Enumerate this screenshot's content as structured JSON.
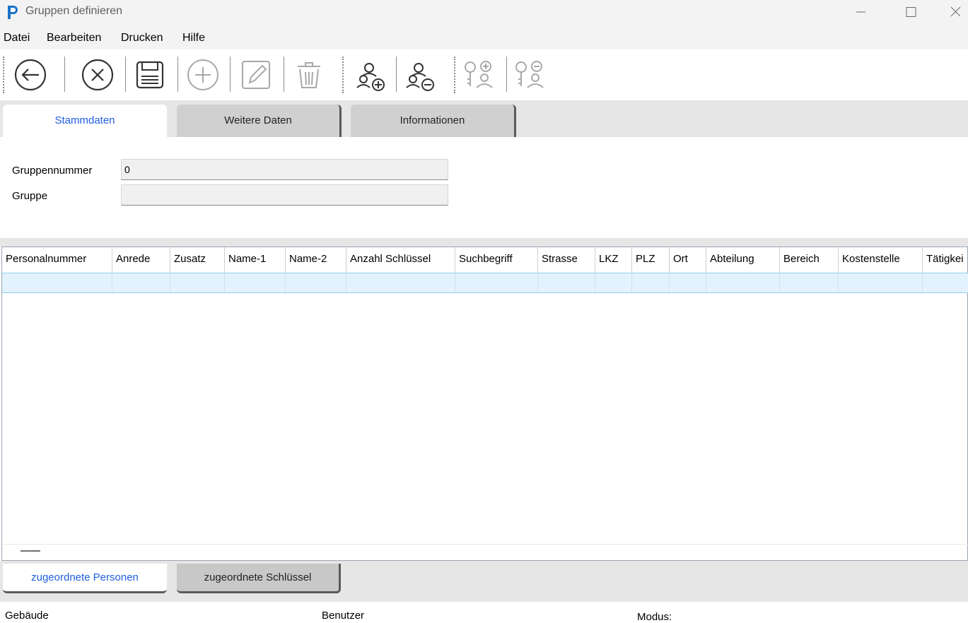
{
  "window": {
    "title": "Gruppen definieren"
  },
  "menu": [
    "Datei",
    "Bearbeiten",
    "Drucken",
    "Hilfe"
  ],
  "toolbar": {
    "buttons": [
      "back-icon",
      "cancel-icon",
      "save-icon",
      "add-icon",
      "edit-icon",
      "delete-icon",
      "add-persons-icon",
      "remove-persons-icon",
      "add-keys-icon",
      "remove-keys-icon"
    ],
    "disabled": [
      "add-icon",
      "edit-icon",
      "delete-icon",
      "add-keys-icon",
      "remove-keys-icon"
    ]
  },
  "tabs": [
    "Stammdaten",
    "Weitere Daten",
    "Informationen"
  ],
  "form": {
    "gruppennummer_label": "Gruppennummer",
    "gruppennummer_value": "0",
    "gruppe_label": "Gruppe",
    "gruppe_value": ""
  },
  "grid": {
    "columns": [
      "Personalnummer",
      "Anrede",
      "Zusatz",
      "Name-1",
      "Name-2",
      "Anzahl Schlüssel",
      "Suchbegriff",
      "Strasse",
      "LKZ",
      "PLZ",
      "Ort",
      "Abteilung",
      "Bereich",
      "Kostenstelle",
      "Tätigkei"
    ]
  },
  "bottom_tabs": [
    "zugeordnete Personen",
    "zugeordnete Schlüssel"
  ],
  "status": {
    "gebaeude": "Gebäude",
    "benutzer": "Benutzer",
    "modus": "Modus:"
  },
  "colors": {
    "accent": "#1f5fe0",
    "selection": "#e3f2fc",
    "logo": "#1a73c9"
  }
}
